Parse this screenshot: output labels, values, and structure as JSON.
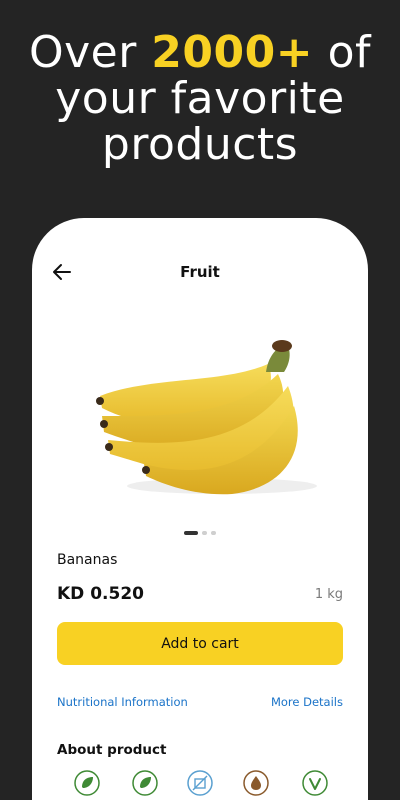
{
  "headline": {
    "line1_prefix": "Over ",
    "line1_highlight": "2000+",
    "line1_suffix": " of",
    "line2": "your favorite",
    "line3": "products"
  },
  "screen": {
    "title": "Fruit",
    "back_icon": "arrow-left-icon"
  },
  "product": {
    "name": "Bananas",
    "price": "KD 0.520",
    "unit": "1 kg",
    "image": "bananas-photo",
    "gallery": {
      "total": 3,
      "active": 1
    }
  },
  "actions": {
    "add_to_cart": "Add to cart",
    "nutritional_info": "Nutritional Information",
    "more_details": "More Details"
  },
  "about": {
    "heading": "About product",
    "icons": [
      "leaf-icon",
      "leaf-icon",
      "no-preservatives-icon",
      "oil-drop-icon",
      "vegan-icon"
    ]
  },
  "colors": {
    "background": "#242424",
    "accent": "#f8d123",
    "link": "#1a73c8",
    "icon_green": "#3f8a35"
  }
}
